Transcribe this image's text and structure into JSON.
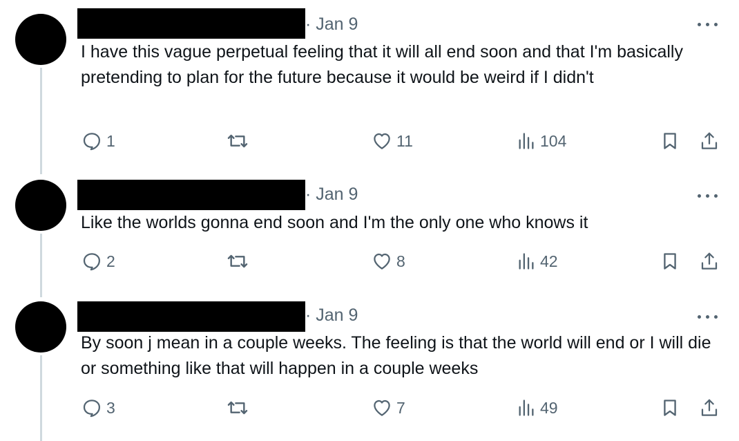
{
  "tweets": [
    {
      "date": "· Jan 9",
      "text": "I have this vague perpetual feeling that it will all end soon and that I'm basically pretending to plan for the future because it would be weird if I didn't",
      "replies": "1",
      "likes": "11",
      "views": "104"
    },
    {
      "date": "· Jan 9",
      "text": "Like the worlds gonna end soon and I'm the only one who knows it",
      "replies": "2",
      "likes": "8",
      "views": "42"
    },
    {
      "date": "· Jan 9",
      "text": "By soon j mean in a couple weeks. The feeling is that the world will end or I will die or something like that will happen in a couple weeks",
      "replies": "3",
      "likes": "7",
      "views": "49"
    }
  ],
  "colors": {
    "text": "#0f1419",
    "muted": "#536471",
    "thread_line": "#cfd9de",
    "redaction": "#000000"
  },
  "icons": [
    "reply-icon",
    "retweet-icon",
    "like-icon",
    "views-icon",
    "bookmark-icon",
    "share-icon",
    "more-icon"
  ]
}
